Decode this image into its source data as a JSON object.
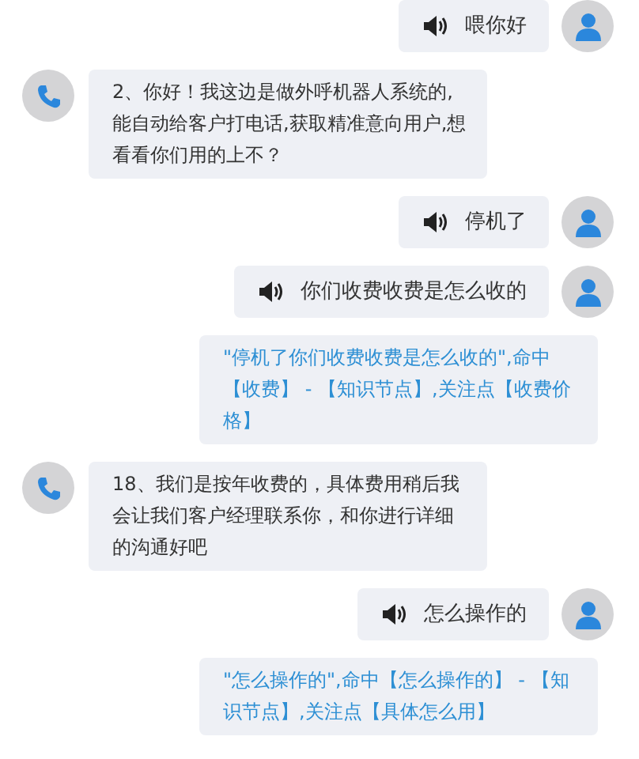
{
  "messages": [
    {
      "kind": "user",
      "text": "喂你好"
    },
    {
      "kind": "bot",
      "text": "2、你好！我这边是做外呼机器人系统的,能自动给客户打电话,获取精准意向用户,想看看你们用的上不？"
    },
    {
      "kind": "user",
      "text": "停机了"
    },
    {
      "kind": "user",
      "text": "你们收费收费是怎么收的"
    },
    {
      "kind": "hit",
      "text": "\"停机了你们收费收费是怎么收的\",命中【收费】 - 【知识节点】,关注点【收费价格】"
    },
    {
      "kind": "bot",
      "text": "18、我们是按年收费的，具体费用稍后我会让我们客户经理联系你，和你进行详细的沟通好吧"
    },
    {
      "kind": "user",
      "text": "怎么操作的"
    },
    {
      "kind": "hit",
      "text": "\"怎么操作的\",命中【怎么操作的】 - 【知识节点】,关注点【具体怎么用】"
    }
  ]
}
